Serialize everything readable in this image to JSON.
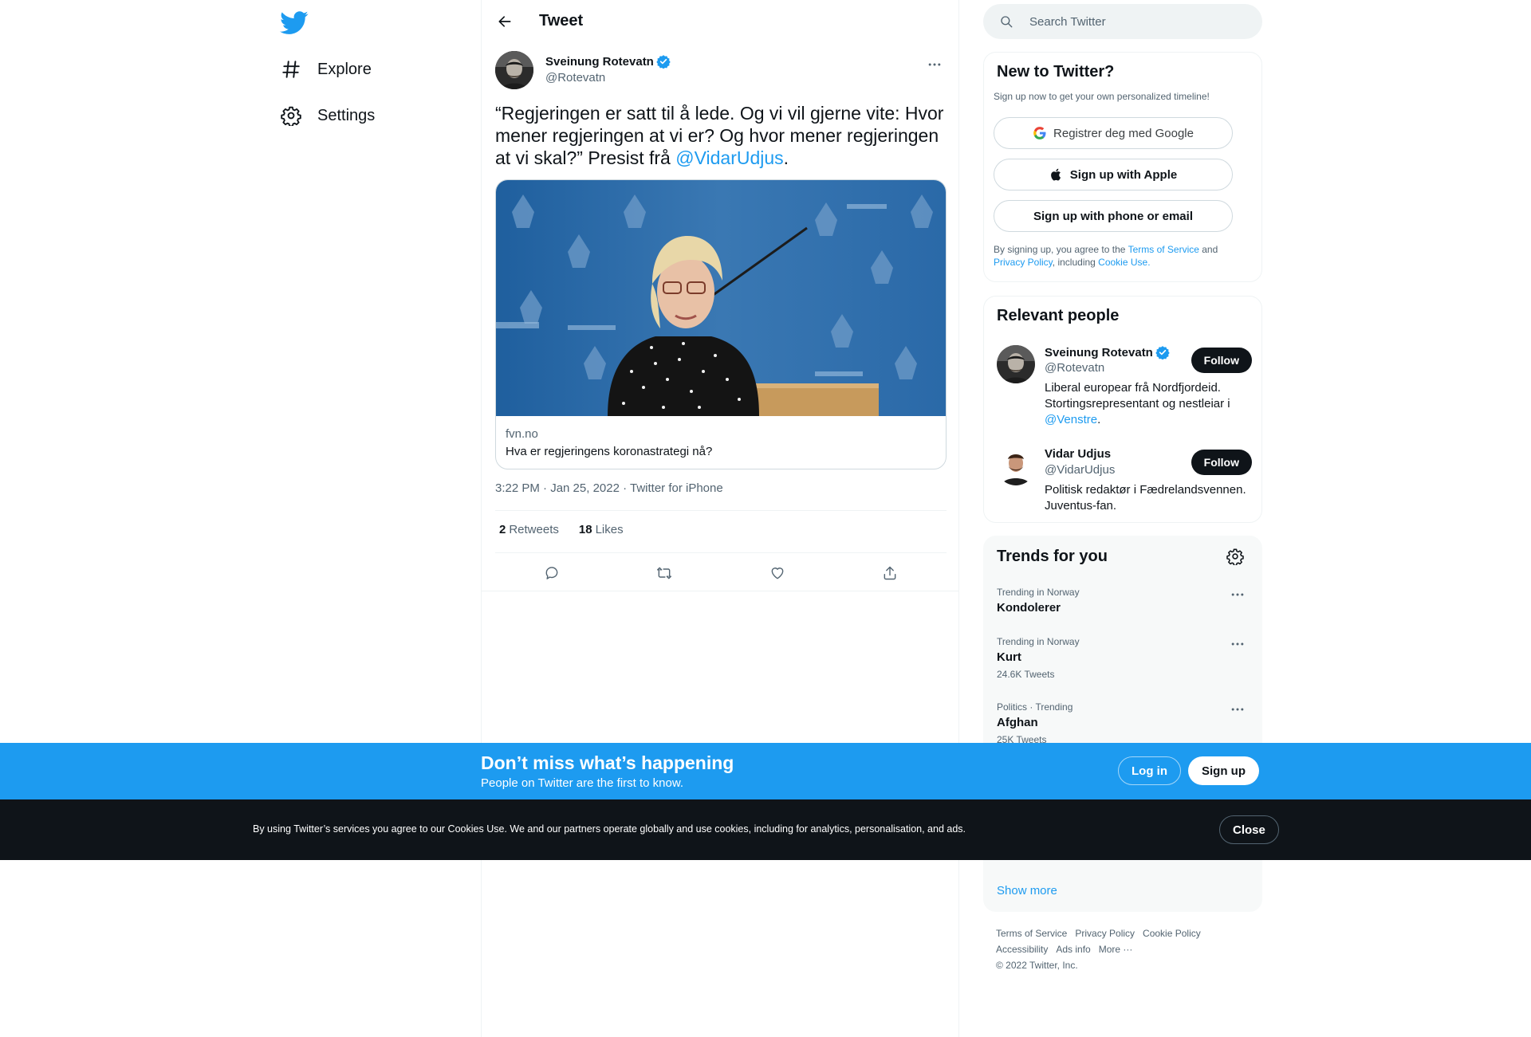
{
  "nav": {
    "items": [
      {
        "label": "Explore",
        "icon": "hashtag-icon"
      },
      {
        "label": "Settings",
        "icon": "gear-icon"
      }
    ]
  },
  "header": {
    "title": "Tweet"
  },
  "tweet": {
    "author_name": "Sveinung Rotevatn",
    "author_handle": "@Rotevatn",
    "text_before": "“Regjeringen er satt til å lede. Og vi vil gjerne vite: Hvor mener regjeringen at vi er? Og hvor mener regjeringen at vi skal?” Presist frå ",
    "mention": "@VidarUdjus",
    "text_after": ".",
    "card": {
      "domain": "fvn.no",
      "title": "Hva er regjeringens koronastrategi nå?"
    },
    "meta": "3:22 PM · Jan 25, 2022 · Twitter for iPhone",
    "retweets_count": "2",
    "retweets_label": "Retweets",
    "likes_count": "18",
    "likes_label": "Likes"
  },
  "search": {
    "placeholder": "Search Twitter"
  },
  "signup_panel": {
    "title": "New to Twitter?",
    "subtitle": "Sign up now to get your own personalized timeline!",
    "google_label": "Registrer deg med Google",
    "apple_label": "Sign up with Apple",
    "phone_label": "Sign up with phone or email",
    "terms_1": "By signing up, you agree to the ",
    "terms_link_1": "Terms of Service",
    "terms_2": " and ",
    "terms_link_2": "Privacy Policy",
    "terms_3": ", including ",
    "terms_link_3": "Cookie Use.",
    "colors": {
      "google_blue": "#4285F4",
      "google_red": "#EA4335",
      "google_yellow": "#FBBC05",
      "google_green": "#34A853"
    }
  },
  "relevant": {
    "title": "Relevant people",
    "people": [
      {
        "name": "Sveinung Rotevatn",
        "handle": "@Rotevatn",
        "bio_before": "Liberal europear frå Nordfjordeid. Stortingsrepresentant og nestleiar i ",
        "bio_link": "@Venstre",
        "bio_after": ".",
        "follow": "Follow",
        "verified": true
      },
      {
        "name": "Vidar Udjus",
        "handle": "@VidarUdjus",
        "bio": "Politisk redaktør i Fædrelandsvennen. Juventus-fan.",
        "follow": "Follow",
        "verified": false
      }
    ]
  },
  "trends": {
    "title": "Trends for you",
    "items": [
      {
        "meta": "Trending in Norway",
        "name": "Kondolerer",
        "count": ""
      },
      {
        "meta": "Trending in Norway",
        "name": "Kurt",
        "count": "24.6K Tweets"
      },
      {
        "meta": "Politics · Trending",
        "name": "Afghan",
        "count": "25K Tweets"
      }
    ],
    "show_more": "Show more"
  },
  "footer": {
    "links": [
      "Terms of Service",
      "Privacy Policy",
      "Cookie Policy",
      "Accessibility",
      "Ads info",
      "More ···"
    ],
    "copyright": "© 2022 Twitter, Inc."
  },
  "bottom_bar": {
    "title": "Don’t miss what’s happening",
    "subtitle": "People on Twitter are the first to know.",
    "login": "Log in",
    "signup": "Sign up"
  },
  "cookie_bar": {
    "text": "By using Twitter’s services you agree to our Cookies Use. We and our partners operate globally and use cookies, including for analytics, personalisation, and ads.",
    "close": "Close"
  },
  "colors": {
    "accent": "#1d9bf0",
    "dark": "#0f1419",
    "muted": "#536471",
    "border": "#eff3f4"
  }
}
